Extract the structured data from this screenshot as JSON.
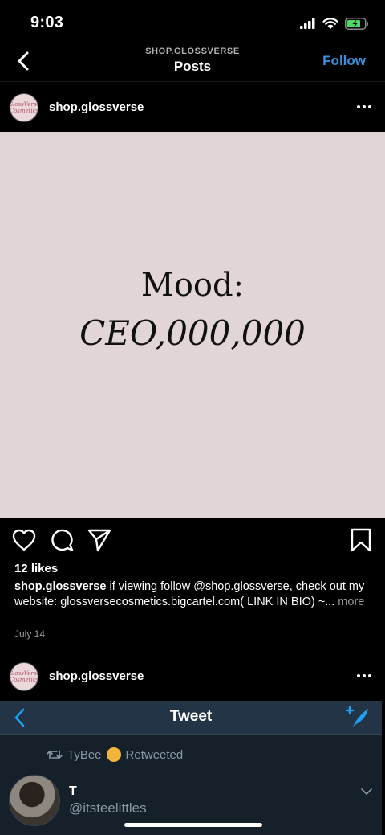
{
  "status_bar": {
    "time": "9:03"
  },
  "nav": {
    "subtitle": "SHOP.GLOSSVERSE",
    "title": "Posts",
    "follow_label": "Follow"
  },
  "posts": [
    {
      "username": "shop.glossverse",
      "avatar_logo_text": "GlossVerse Cosmetics",
      "image_text_line1": "Mood:",
      "image_text_line2": "CEO,000,000",
      "likes": "12 likes",
      "caption_user": "shop.glossverse",
      "caption_text": " if viewing follow @shop.glossverse, check out my website: glossversecosmetics.bigcartel.com( LINK IN BIO) ~...",
      "caption_more": " more",
      "date": "July 14"
    },
    {
      "username": "shop.glossverse",
      "avatar_logo_text": "GlossVerse Cosmetics"
    }
  ],
  "tweet": {
    "header_title": "Tweet",
    "retweeted_by": "TyBee",
    "retweeted_label": "Retweeted",
    "name": "T",
    "handle": "@itsteelittles"
  },
  "colors": {
    "accent": "#3d8fdc",
    "twitter_bg": "#15202b",
    "twitter_header": "#243447",
    "image_bg": "#e2d5d6"
  },
  "icons": [
    "back-chevron-icon",
    "signal-icon",
    "wifi-icon",
    "battery-icon",
    "more-icon",
    "heart-icon",
    "comment-icon",
    "share-icon",
    "bookmark-icon",
    "retweet-icon",
    "compose-tweet-icon",
    "chevron-down-icon"
  ]
}
